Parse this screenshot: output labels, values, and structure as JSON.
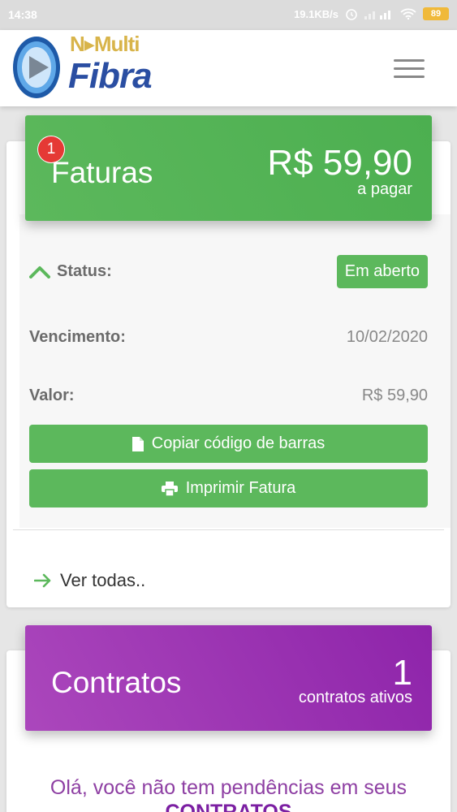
{
  "status_bar": {
    "time": "14:38",
    "network_speed": "19.1KB/s",
    "battery": "89"
  },
  "header": {
    "logo_top": "N▸Multi",
    "logo_bottom": "Fibra",
    "menu_icon": "hamburger-icon"
  },
  "faturas": {
    "badge": "1",
    "title": "Faturas",
    "amount": "R$ 59,90",
    "amount_caption": "a pagar",
    "status_label": "Status:",
    "status_value": "Em aberto",
    "vencimento_label": "Vencimento:",
    "vencimento_value": "10/02/2020",
    "valor_label": "Valor:",
    "valor_value": "R$ 59,90",
    "copy_button": "Copiar código de barras",
    "print_button": "Imprimir Fatura",
    "see_all": "Ver todas.."
  },
  "contratos": {
    "title": "Contratos",
    "count": "1",
    "count_caption": "contratos ativos",
    "message": "Olá, você não tem pendências em seus",
    "message_bold": "CONTRATOS"
  },
  "colors": {
    "green": "#5cb85c",
    "purple": "#9c27b0",
    "badge_red": "#e53935"
  }
}
